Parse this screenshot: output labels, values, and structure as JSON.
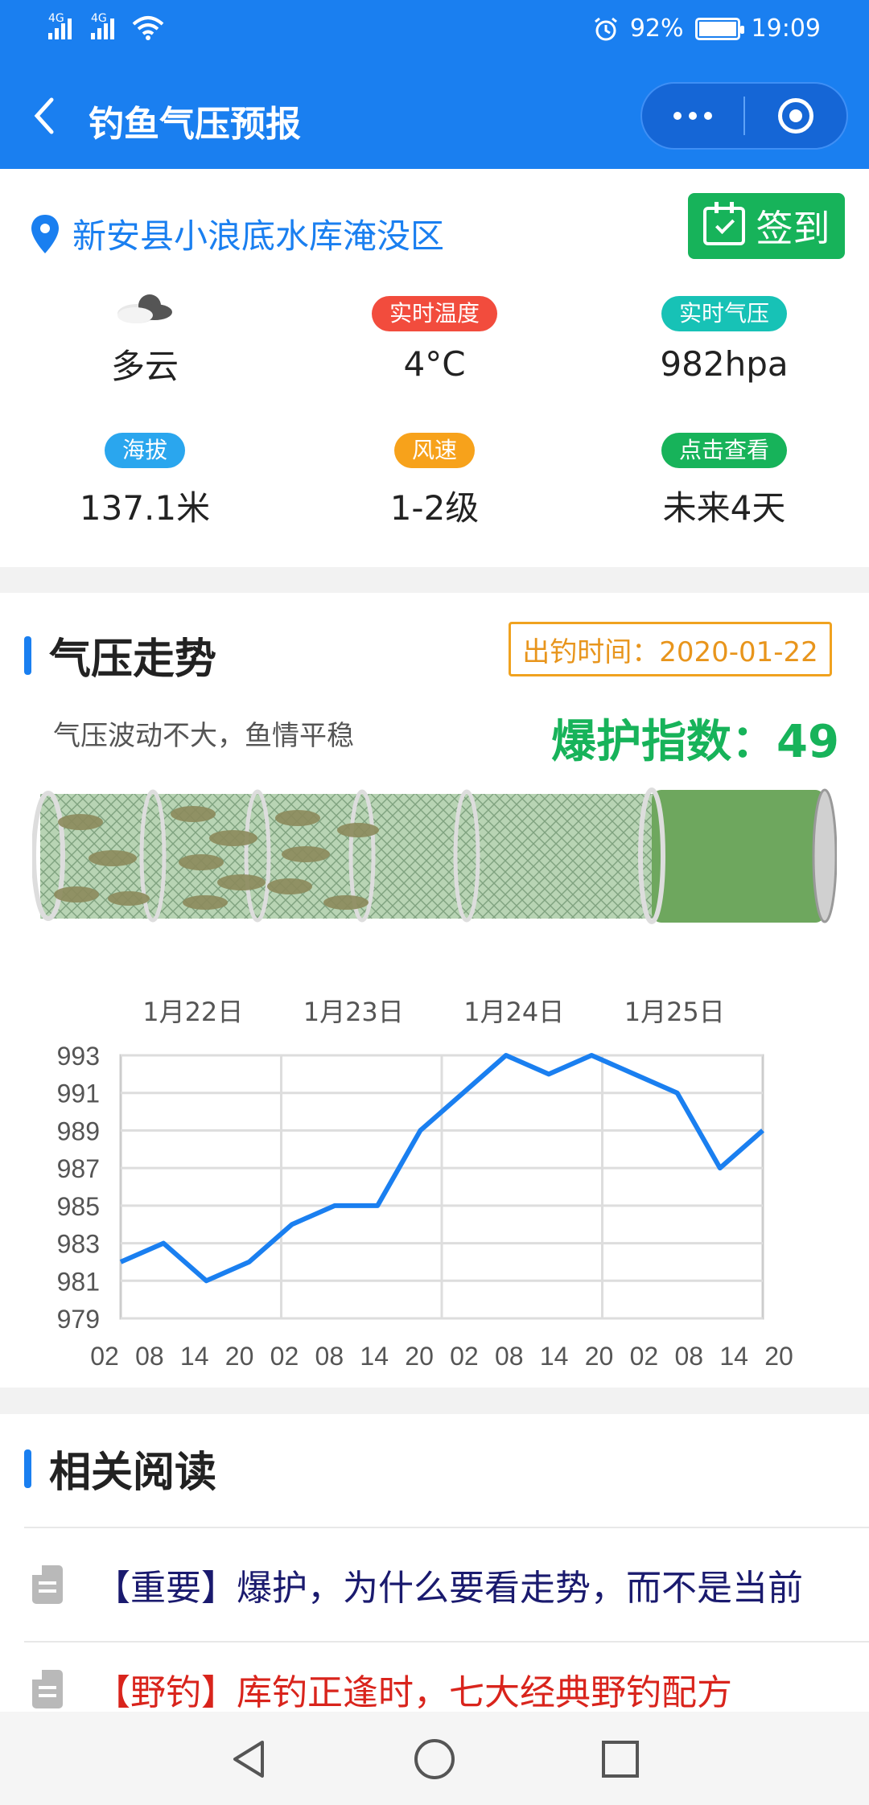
{
  "status": {
    "left": "4G 4G",
    "net_left": "4G",
    "net_right": "4G",
    "battery": "92%",
    "time": "19:09",
    "battery_level": 0.92
  },
  "nav": {
    "title": "钓鱼气压预报"
  },
  "location": {
    "name": "新安县小浪底水库淹没区"
  },
  "signin": {
    "label": "签到"
  },
  "weather": {
    "condition": "多云",
    "temp_label": "实时温度",
    "temp": "4°C",
    "pressure_label": "实时气压",
    "pressure": "982hpa",
    "altitude_label": "海拔",
    "altitude": "137.1米",
    "wind_label": "风速",
    "wind": "1-2级",
    "more_label": "点击查看",
    "more": "未来4天",
    "colors": {
      "temp": "#f24c3d",
      "pressure": "#17c2b6",
      "altitude": "#2aa6ee",
      "wind": "#f7a21b",
      "more": "#17b35a"
    }
  },
  "trend": {
    "title": "气压走势",
    "date": "出钓时间：2020-01-22",
    "desc": "气压波动不大，鱼情平稳",
    "index": "爆护指数：49",
    "index_value": 49
  },
  "chart_data": {
    "type": "line",
    "day_labels": [
      "1月22日",
      "1月23日",
      "1月24日",
      "1月25日"
    ],
    "categories": [
      "02",
      "08",
      "14",
      "20",
      "02",
      "08",
      "14",
      "20",
      "02",
      "08",
      "14",
      "20",
      "02",
      "08",
      "14",
      "20"
    ],
    "values": [
      982,
      983,
      981,
      982,
      984,
      985,
      985,
      989,
      991,
      993,
      992,
      993,
      992,
      991,
      987,
      989
    ],
    "yticks": [
      993,
      991,
      989,
      987,
      985,
      983,
      981,
      979
    ],
    "ylim": [
      979,
      993
    ],
    "grid": true,
    "color": "#1a7ff0"
  },
  "reading": {
    "title": "相关阅读",
    "articles": [
      {
        "tag": "【重要】",
        "text": "爆护，为什么要看走势，而不是当前",
        "color": "#1a1a6e"
      },
      {
        "tag": "【野钓】",
        "text": "库钓正逢时，七大经典野钓配方",
        "color": "#d9241c"
      }
    ]
  }
}
